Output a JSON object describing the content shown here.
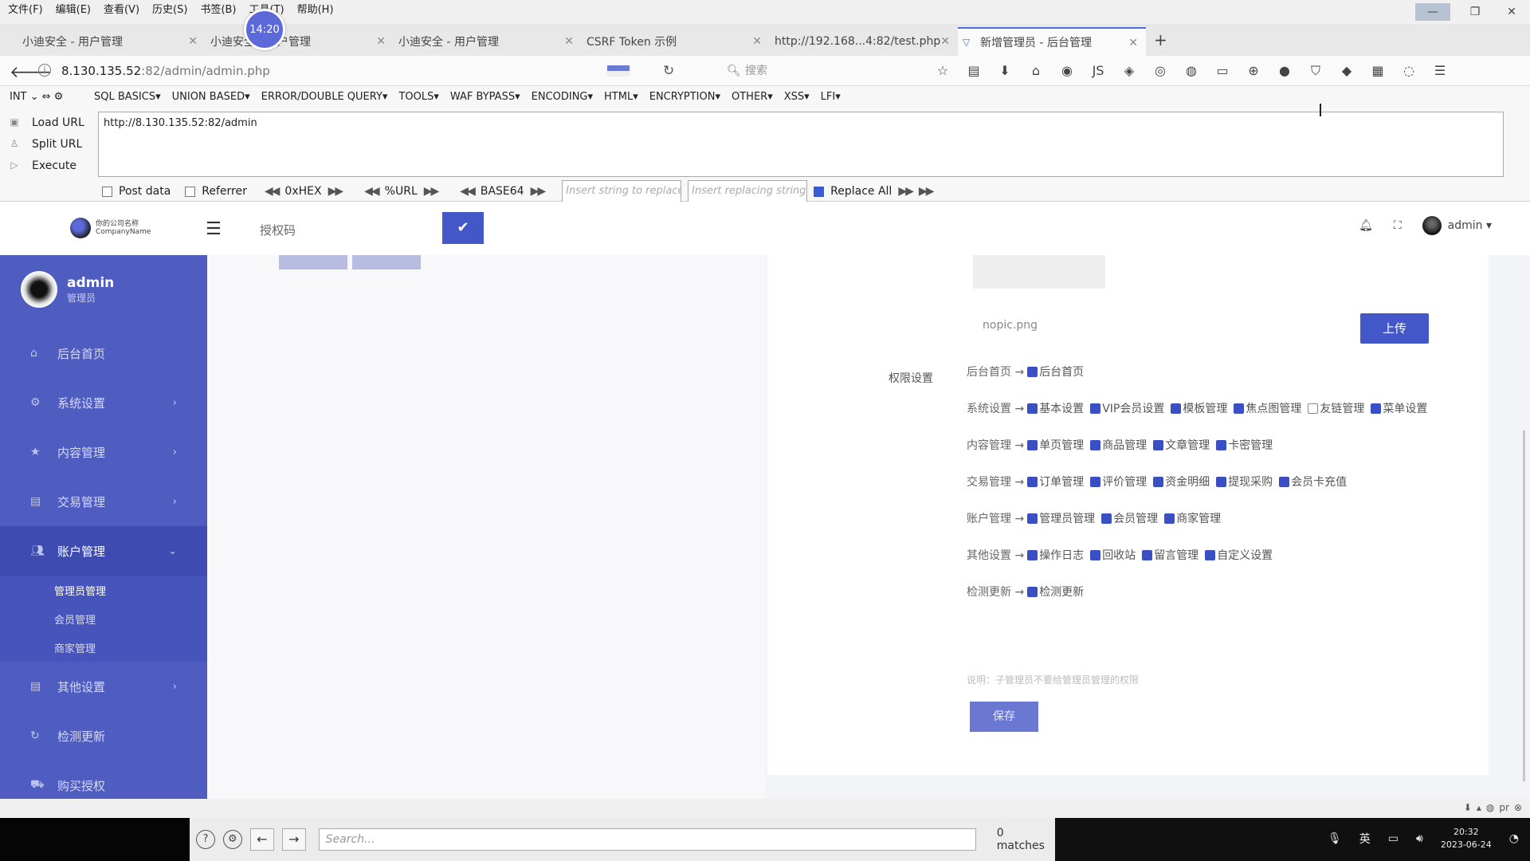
{
  "menubar": {
    "items": [
      "文件(F)",
      "编辑(E)",
      "查看(V)",
      "历史(S)",
      "书签(B)",
      "工具(T)",
      "帮助(H)"
    ]
  },
  "timer_badge": "14:20",
  "tabs": [
    {
      "label": "小迪安全 - 用户管理",
      "active": false
    },
    {
      "label": "小迪安全 - 用户管理",
      "active": false
    },
    {
      "label": "小迪安全 - 用户管理",
      "active": false
    },
    {
      "label": "CSRF Token 示例",
      "active": false
    },
    {
      "label": "http://192.168...4:82/test.php",
      "active": false
    },
    {
      "label": "新增管理员 - 后台管理",
      "active": true
    }
  ],
  "tab_new_label": "+",
  "navbar": {
    "url_host": "8.130.135.52",
    "url_rest": ":82/admin/admin.php",
    "search_placeholder": "搜索"
  },
  "hackbar": {
    "int_select": "INT",
    "menu": [
      "SQL BASICS▾",
      "UNION BASED▾",
      "ERROR/DOUBLE QUERY▾",
      "TOOLS▾",
      "WAF BYPASS▾",
      "ENCODING▾",
      "HTML▾",
      "ENCRYPTION▾",
      "OTHER▾",
      "XSS▾",
      "LFI▾"
    ],
    "load_url": "Load URL",
    "split_url": "Split URL",
    "execute": "Execute",
    "url_value": "http://8.130.135.52:82/admin",
    "post_data": "Post data",
    "referrer": "Referrer",
    "hex": "0xHEX",
    "urlenc": "%URL",
    "base64": "BASE64",
    "replace_placeholder": "Insert string to replace",
    "replacing_placeholder": "Insert replacing string",
    "replace_all": "Replace All"
  },
  "app_header": {
    "logo_text_1": "你的公司名称",
    "logo_text_2": "CompanyName",
    "auth_code_label": "授权码",
    "user": "admin ▾"
  },
  "sidebar": {
    "username": "admin",
    "role": "管理员",
    "items": [
      {
        "label": "后台首页",
        "chev": ""
      },
      {
        "label": "系统设置",
        "chev": "›"
      },
      {
        "label": "内容管理",
        "chev": "›"
      },
      {
        "label": "交易管理",
        "chev": "›"
      },
      {
        "label": "账户管理",
        "chev": "⌄"
      },
      {
        "label": "其他设置",
        "chev": "›"
      },
      {
        "label": "检测更新",
        "chev": ""
      },
      {
        "label": "购买授权",
        "chev": ""
      }
    ],
    "sub_items": [
      "管理员管理",
      "会员管理",
      "商家管理"
    ]
  },
  "panel": {
    "filename": "nopic.png",
    "upload_label": "上传",
    "perm_label": "权限设置",
    "groups": [
      {
        "name": "后台首页 →",
        "items": [
          {
            "label": "后台首页",
            "checked": true
          }
        ]
      },
      {
        "name": "系统设置 →",
        "items": [
          {
            "label": "基本设置",
            "checked": true
          },
          {
            "label": "VIP会员设置",
            "checked": true
          },
          {
            "label": "模板管理",
            "checked": true
          },
          {
            "label": "焦点图管理",
            "checked": true
          },
          {
            "label": "友链管理",
            "checked": false
          },
          {
            "label": "菜单设置",
            "checked": true
          }
        ]
      },
      {
        "name": "内容管理 →",
        "items": [
          {
            "label": "单页管理",
            "checked": true
          },
          {
            "label": "商品管理",
            "checked": true
          },
          {
            "label": "文章管理",
            "checked": true
          },
          {
            "label": "卡密管理",
            "checked": true
          }
        ]
      },
      {
        "name": "交易管理 →",
        "items": [
          {
            "label": "订单管理",
            "checked": true
          },
          {
            "label": "评价管理",
            "checked": true
          },
          {
            "label": "资金明细",
            "checked": true
          },
          {
            "label": "提现采购",
            "checked": true
          },
          {
            "label": "会员卡充值",
            "checked": true
          }
        ]
      },
      {
        "name": "账户管理 →",
        "items": [
          {
            "label": "管理员管理",
            "checked": true
          },
          {
            "label": "会员管理",
            "checked": true
          },
          {
            "label": "商家管理",
            "checked": true
          }
        ]
      },
      {
        "name": "其他设置 →",
        "items": [
          {
            "label": "操作日志",
            "checked": true
          },
          {
            "label": "回收站",
            "checked": true
          },
          {
            "label": "留言管理",
            "checked": true
          },
          {
            "label": "自定义设置",
            "checked": true
          }
        ]
      },
      {
        "name": "检测更新 →",
        "items": [
          {
            "label": "检测更新",
            "checked": true
          }
        ]
      }
    ],
    "note": "说明：子管理员不要给管理员管理的权限",
    "save_label": "保存"
  },
  "findbar": {
    "placeholder": "Search...",
    "matches": "0 matches"
  },
  "tray": {
    "lang": "英",
    "time": "20:32",
    "date": "2023-06-24"
  },
  "colors": {
    "accent": "#4357c8",
    "sidebar": "#4f5dc1"
  }
}
